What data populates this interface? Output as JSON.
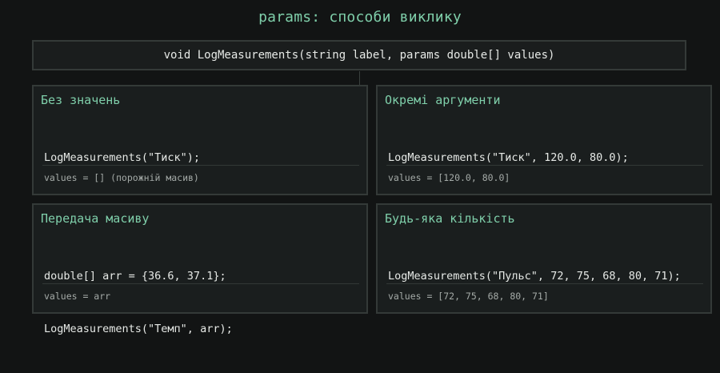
{
  "title": "params: способи виклику",
  "signature": "void LogMeasurements(string label, params double[] values)",
  "cards": [
    {
      "title": "Без значень",
      "code": [
        "LogMeasurements(\"Тиск\");"
      ],
      "result": "values = [] (порожній масив)"
    },
    {
      "title": "Окремі аргументи",
      "code": [
        "LogMeasurements(\"Тиск\", 120.0, 80.0);"
      ],
      "result": "values = [120.0, 80.0]"
    },
    {
      "title": "Передача масиву",
      "code": [
        "double[] arr = {36.6, 37.1};",
        "LogMeasurements(\"Темп\", arr);"
      ],
      "result": "values = arr"
    },
    {
      "title": "Будь-яка кількість",
      "code": [
        "LogMeasurements(\"Пульс\", 72, 75, 68, 80, 71);"
      ],
      "result": "values = [72, 75, 68, 80, 71]"
    }
  ],
  "colors": {
    "accent": "#7fcfaa",
    "background": "#121414",
    "panel": "#1a1e1e",
    "border": "#343a38"
  }
}
